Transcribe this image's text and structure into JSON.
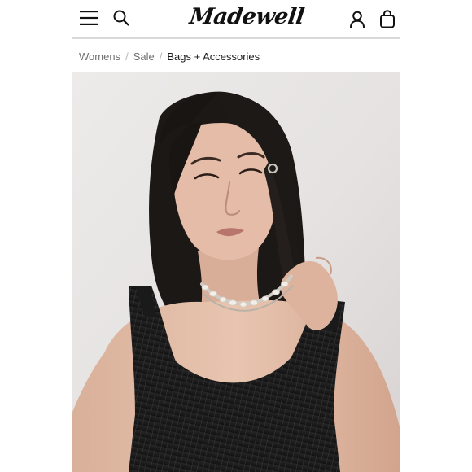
{
  "header": {
    "brand": "Madewell",
    "icons": {
      "menu": "hamburger-menu-icon",
      "search": "search-icon",
      "account": "account-icon",
      "bag": "shopping-bag-icon"
    }
  },
  "breadcrumb": [
    {
      "label": "Womens"
    },
    {
      "label": "Sale"
    },
    {
      "label": "Bags + Accessories"
    }
  ],
  "colors": {
    "text": "#1a1a1a",
    "muted": "#6f6f6f",
    "divider": "#d9d9d9",
    "hero_background": "#e6e3e2"
  }
}
